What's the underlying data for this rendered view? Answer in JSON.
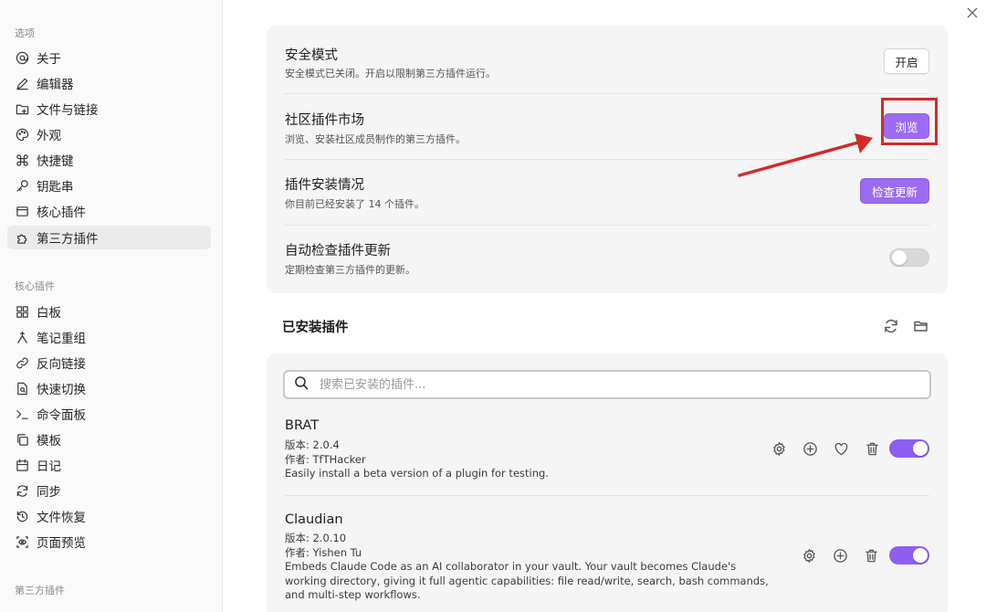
{
  "sidebar": {
    "options_title": "选项",
    "options": [
      {
        "label": "关于",
        "icon": "at-icon"
      },
      {
        "label": "编辑器",
        "icon": "pen-icon"
      },
      {
        "label": "文件与链接",
        "icon": "folder-link-icon"
      },
      {
        "label": "外观",
        "icon": "palette-icon"
      },
      {
        "label": "快捷键",
        "icon": "command-icon"
      },
      {
        "label": "钥匙串",
        "icon": "key-icon"
      },
      {
        "label": "核心插件",
        "icon": "box-icon"
      },
      {
        "label": "第三方插件",
        "icon": "puzzle-icon",
        "active": true
      }
    ],
    "core_title": "核心插件",
    "core": [
      {
        "label": "白板",
        "icon": "grid-icon"
      },
      {
        "label": "笔记重组",
        "icon": "merge-icon"
      },
      {
        "label": "反向链接",
        "icon": "link-icon"
      },
      {
        "label": "快速切换",
        "icon": "file-search-icon"
      },
      {
        "label": "命令面板",
        "icon": "terminal-icon"
      },
      {
        "label": "模板",
        "icon": "copy-icon"
      },
      {
        "label": "日记",
        "icon": "calendar-icon"
      },
      {
        "label": "同步",
        "icon": "sync-icon"
      },
      {
        "label": "文件恢复",
        "icon": "history-icon"
      },
      {
        "label": "页面预览",
        "icon": "eye-icon"
      }
    ],
    "third_title": "第三方插件"
  },
  "settings": {
    "safe_mode": {
      "title": "安全模式",
      "desc": "安全模式已关闭。开启以限制第三方插件运行。",
      "button": "开启"
    },
    "community": {
      "title": "社区插件市场",
      "desc": "浏览、安装社区成员制作的第三方插件。",
      "button": "浏览"
    },
    "install_status": {
      "title": "插件安装情况",
      "desc": "你目前已经安装了 14 个插件。",
      "button": "检查更新"
    },
    "auto_check": {
      "title": "自动检查插件更新",
      "desc": "定期检查第三方插件的更新。",
      "enabled": false
    }
  },
  "installed": {
    "title": "已安装插件",
    "search_placeholder": "搜索已安装的插件...",
    "plugins": [
      {
        "name": "BRAT",
        "version": "版本: 2.0.4",
        "author": "作者: TfTHacker",
        "desc": "Easily install a beta version of a plugin for testing.",
        "enabled": true
      },
      {
        "name": "Claudian",
        "version": "版本: 2.0.10",
        "author": "作者: Yishen Tu",
        "desc": "Embeds Claude Code as an AI collaborator in your vault. Your vault becomes Claude's working directory, giving it full agentic capabilities: file read/write, search, bash commands, and multi-step workflows.",
        "enabled": true
      }
    ]
  },
  "colors": {
    "accent": "#9b6cf2",
    "highlight": "#d42a2a"
  }
}
